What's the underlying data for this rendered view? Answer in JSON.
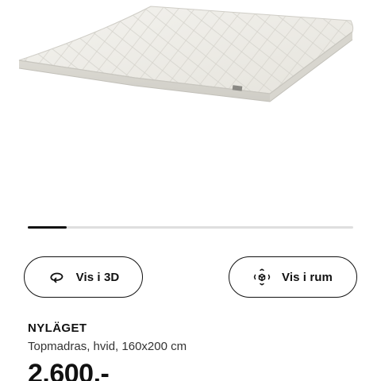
{
  "product": {
    "image_icon": "mattress-topper-photo",
    "name": "NYLÄGET",
    "description": "Topmadras, hvid, 160x200 cm",
    "price": "2.600,-"
  },
  "carousel": {
    "current_fraction": 0.12
  },
  "actions": {
    "view_3d": {
      "label": "Vis i 3D",
      "icon": "rotate-3d-icon"
    },
    "view_in_room": {
      "label": "Vis i rum",
      "icon": "ar-cube-icon"
    }
  },
  "colors": {
    "text": "#111111",
    "mattress": "#eeece6",
    "track": "#dfdfdf"
  }
}
